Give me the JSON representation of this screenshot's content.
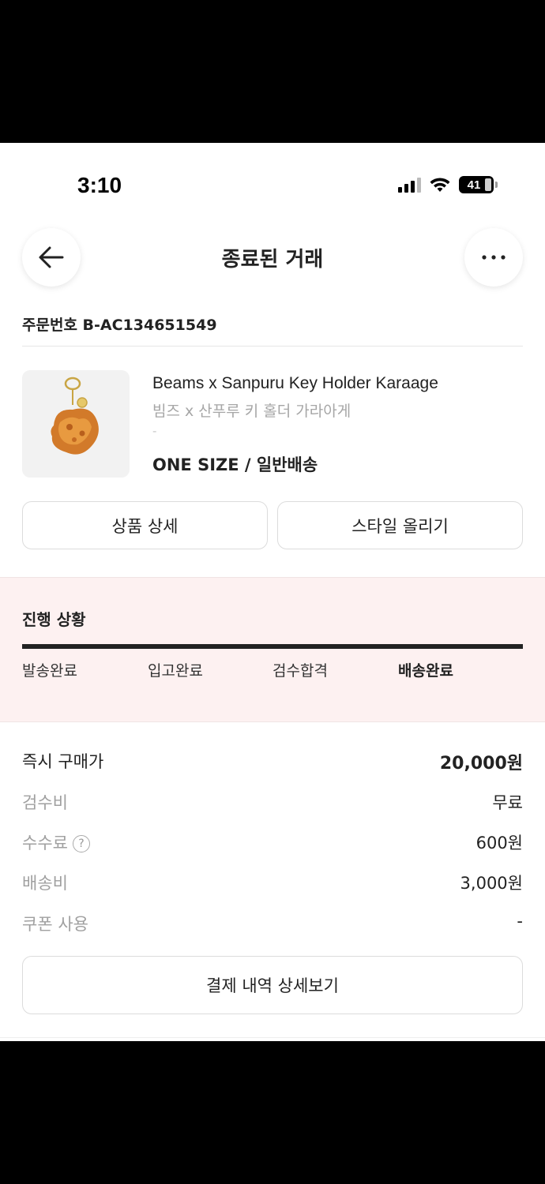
{
  "status": {
    "time": "3:10",
    "battery": "41"
  },
  "header": {
    "title": "종료된 거래"
  },
  "order": {
    "number_text": "주문번호 B-AC134651549"
  },
  "product": {
    "name_en": "Beams x Sanpuru Key Holder Karaage",
    "name_ko": "빔즈 x 산푸루 키 홀더 가라아게",
    "sub": "-",
    "option": "ONE SIZE / 일반배송",
    "detail_button": "상품 상세",
    "style_button": "스타일 올리기"
  },
  "progress": {
    "title": "진행 상황",
    "steps": [
      "발송완료",
      "입고완료",
      "검수합격",
      "배송완료"
    ],
    "active_index": 3
  },
  "price": {
    "rows": [
      {
        "label": "즉시 구매가",
        "value": "20,000원"
      },
      {
        "label": "검수비",
        "value": "무료"
      },
      {
        "label": "수수료",
        "value": "600원"
      },
      {
        "label": "배송비",
        "value": "3,000원"
      },
      {
        "label": "쿠폰 사용",
        "value": "-"
      }
    ],
    "help_icon": "question-circle-icon",
    "payment_button": "결제 내역 상세보기"
  }
}
